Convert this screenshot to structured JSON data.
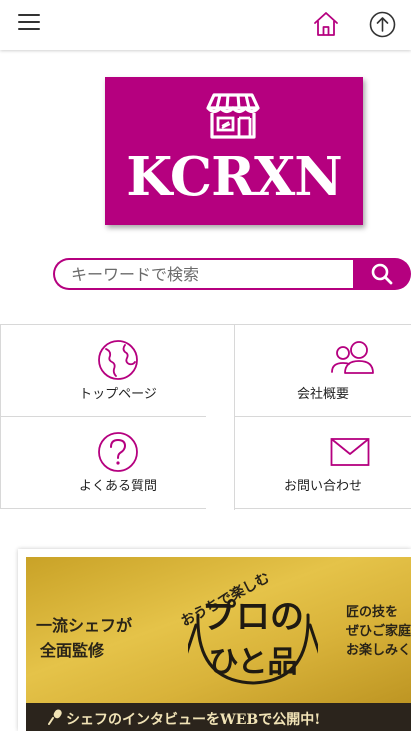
{
  "colors": {
    "accent": "#b5007f",
    "text": "#222222",
    "banner_gold": "#d9b33a",
    "banner_dark": "#2b241c"
  },
  "header": {
    "menu_icon": "hamburger-menu-icon",
    "home_icon": "home-icon",
    "top_icon": "arrow-up-circle-icon"
  },
  "logo": {
    "text": "KCRXN",
    "icon": "storefront-icon"
  },
  "search": {
    "placeholder": "キーワードで検索",
    "icon": "search-icon"
  },
  "nav": {
    "items": [
      {
        "label": "トップページ",
        "icon": "globe-icon"
      },
      {
        "label": "会社概要",
        "icon": "people-icon"
      },
      {
        "label": "よくある質問",
        "icon": "question-circle-icon"
      },
      {
        "label": "お問い合わせ",
        "icon": "mail-icon"
      }
    ]
  },
  "banner": {
    "left_line1": "一流シェフが",
    "left_line2": "全面監修",
    "arc_text": "おうちで楽しむ",
    "title_line1": "プロの",
    "title_line2": "ひと品",
    "right_line1": "匠の技を",
    "right_line2": "ぜひご家庭",
    "right_line3": "お楽しみくださ",
    "strip_text": "シェフのインタビューをWEBで公開中!"
  }
}
